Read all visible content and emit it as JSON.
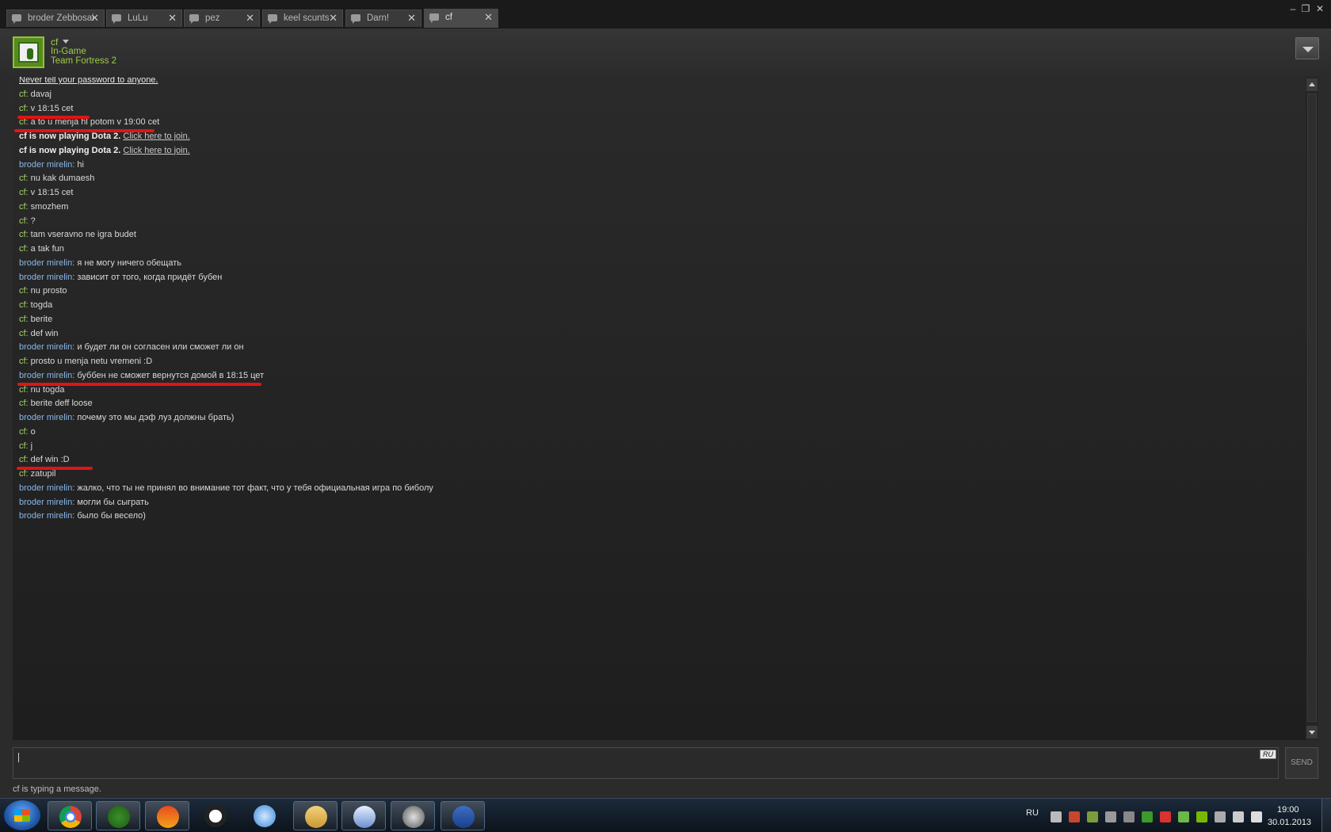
{
  "tabs": [
    {
      "label": "broder Zebbosai",
      "close": "✕"
    },
    {
      "label": "LuLu",
      "close": "✕"
    },
    {
      "label": "pez",
      "close": "✕"
    },
    {
      "label": "keel scunts",
      "close": "✕"
    },
    {
      "label": "Darn!",
      "close": "✕"
    },
    {
      "label": "cf",
      "close": "✕"
    }
  ],
  "window_controls": {
    "minimize": "‒",
    "maximize": "❐",
    "close": "✕"
  },
  "header": {
    "name": "cf",
    "status": "In-Game",
    "game": "Team Fortress 2"
  },
  "chat": {
    "warning": "Never tell your password to anyone.",
    "messages": [
      {
        "sender": "cf",
        "text": "davaj"
      },
      {
        "sender": "cf",
        "text": "v 18:15 cet"
      },
      {
        "sender": "cf",
        "text": "a to u menja hl potom v 19:00 cet"
      },
      {
        "system": "cf is now playing Dota 2.",
        "link": "Click here to join."
      },
      {
        "system": "cf is now playing Dota 2.",
        "link": "Click here to join."
      },
      {
        "sender": "broder mirelin",
        "text": "hi"
      },
      {
        "sender": "cf",
        "text": "nu kak dumaesh"
      },
      {
        "sender": "cf",
        "text": "v 18:15 cet"
      },
      {
        "sender": "cf",
        "text": "smozhem"
      },
      {
        "sender": "cf",
        "text": "?"
      },
      {
        "sender": "cf",
        "text": "tam vseravno ne igra budet"
      },
      {
        "sender": "cf",
        "text": "a tak fun"
      },
      {
        "sender": "broder mirelin",
        "text": "я не могу ничего обещать"
      },
      {
        "sender": "broder mirelin",
        "text": "зависит от того, когда придёт бубен"
      },
      {
        "sender": "cf",
        "text": "nu prosto"
      },
      {
        "sender": "cf",
        "text": "togda"
      },
      {
        "sender": "cf",
        "text": "berite"
      },
      {
        "sender": "cf",
        "text": "def win"
      },
      {
        "sender": "broder mirelin",
        "text": "и будет ли он согласен или сможет ли он"
      },
      {
        "sender": "cf",
        "text": "prosto u menja netu vremeni :D"
      },
      {
        "sender": "broder mirelin",
        "text": "буббен не сможет вернутся домой в 18:15 цет"
      },
      {
        "sender": "cf",
        "text": "nu togda"
      },
      {
        "sender": "cf",
        "text": "berite deff loose"
      },
      {
        "sender": "broder mirelin",
        "text": "почему это мы дэф луз должны брать)"
      },
      {
        "sender": "cf",
        "text": "o"
      },
      {
        "sender": "cf",
        "text": "j"
      },
      {
        "sender": "cf",
        "text": "def win :D"
      },
      {
        "sender": "cf",
        "text": "zatupil"
      },
      {
        "sender": "broder mirelin",
        "text": "жалко, что ты не принял во внимание тот факт, что у тебя официальная игра по биболу"
      },
      {
        "sender": "broder mirelin",
        "text": "могли бы сыграть"
      },
      {
        "sender": "broder mirelin",
        "text": "было бы весело)"
      }
    ]
  },
  "input": {
    "value": "",
    "lang_badge": "RU"
  },
  "send_label": "SEND",
  "typing_status": "cf is typing a message.",
  "taskbar": {
    "apps": [
      "chrome-icon",
      "utorrent-icon",
      "paint-icon",
      "ultrabook-icon",
      "safari-icon",
      "explorer-icon",
      "media-icon",
      "steam-icon",
      "word-icon"
    ],
    "lang": "RU",
    "time": "19:00",
    "date": "30.01.2013"
  },
  "colors": {
    "cf_name": "#a8d56a",
    "broder_name": "#8bb7e8",
    "highlight_line": "#e01414"
  }
}
